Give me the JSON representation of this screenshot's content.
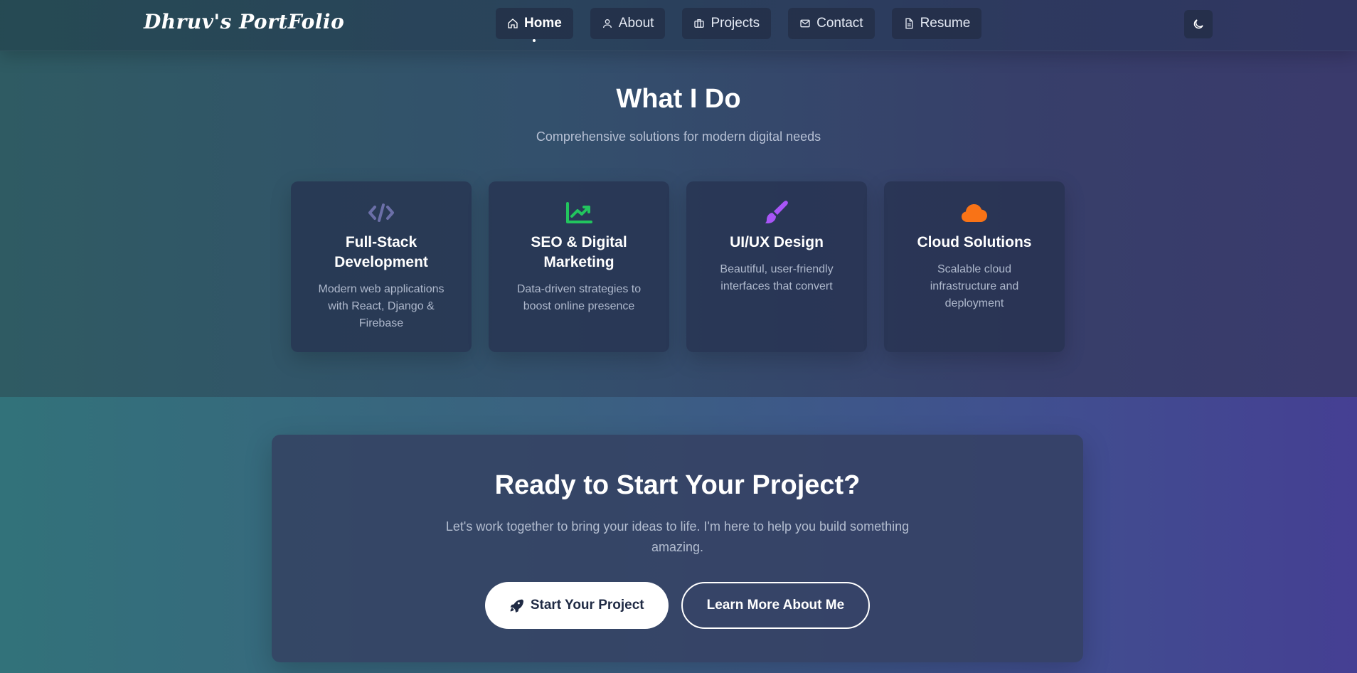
{
  "brand": "Dhruv's PortFolio",
  "nav": {
    "items": [
      {
        "label": "Home",
        "icon": "home-icon",
        "active": true
      },
      {
        "label": "About",
        "icon": "user-icon",
        "active": false
      },
      {
        "label": "Projects",
        "icon": "briefcase-icon",
        "active": false
      },
      {
        "label": "Contact",
        "icon": "mail-icon",
        "active": false
      },
      {
        "label": "Resume",
        "icon": "document-icon",
        "active": false
      }
    ],
    "theme_toggle_icon": "moon-icon"
  },
  "services": {
    "title": "What I Do",
    "subtitle": "Comprehensive solutions for modern digital needs",
    "cards": [
      {
        "icon": "code-icon",
        "icon_color": "#6b6fa8",
        "title": "Full-Stack Development",
        "desc": "Modern web applications with React, Django & Firebase"
      },
      {
        "icon": "chart-line-icon",
        "icon_color": "#22c55e",
        "title": "SEO & Digital Marketing",
        "desc": "Data-driven strategies to boost online presence"
      },
      {
        "icon": "paintbrush-icon",
        "icon_color": "#a855f7",
        "title": "UI/UX Design",
        "desc": "Beautiful, user-friendly interfaces that convert"
      },
      {
        "icon": "cloud-icon",
        "icon_color": "#f97316",
        "title": "Cloud Solutions",
        "desc": "Scalable cloud infrastructure and deployment"
      }
    ]
  },
  "cta": {
    "title": "Ready to Start Your Project?",
    "text": "Let's work together to bring your ideas to life. I'm here to help you build something amazing.",
    "primary_label": "Start Your Project",
    "primary_icon": "rocket-icon",
    "secondary_label": "Learn More About Me"
  },
  "colors": {
    "card_bg": "#26304e",
    "primary_button_bg": "#ffffff",
    "primary_button_text": "#1f2a44"
  }
}
